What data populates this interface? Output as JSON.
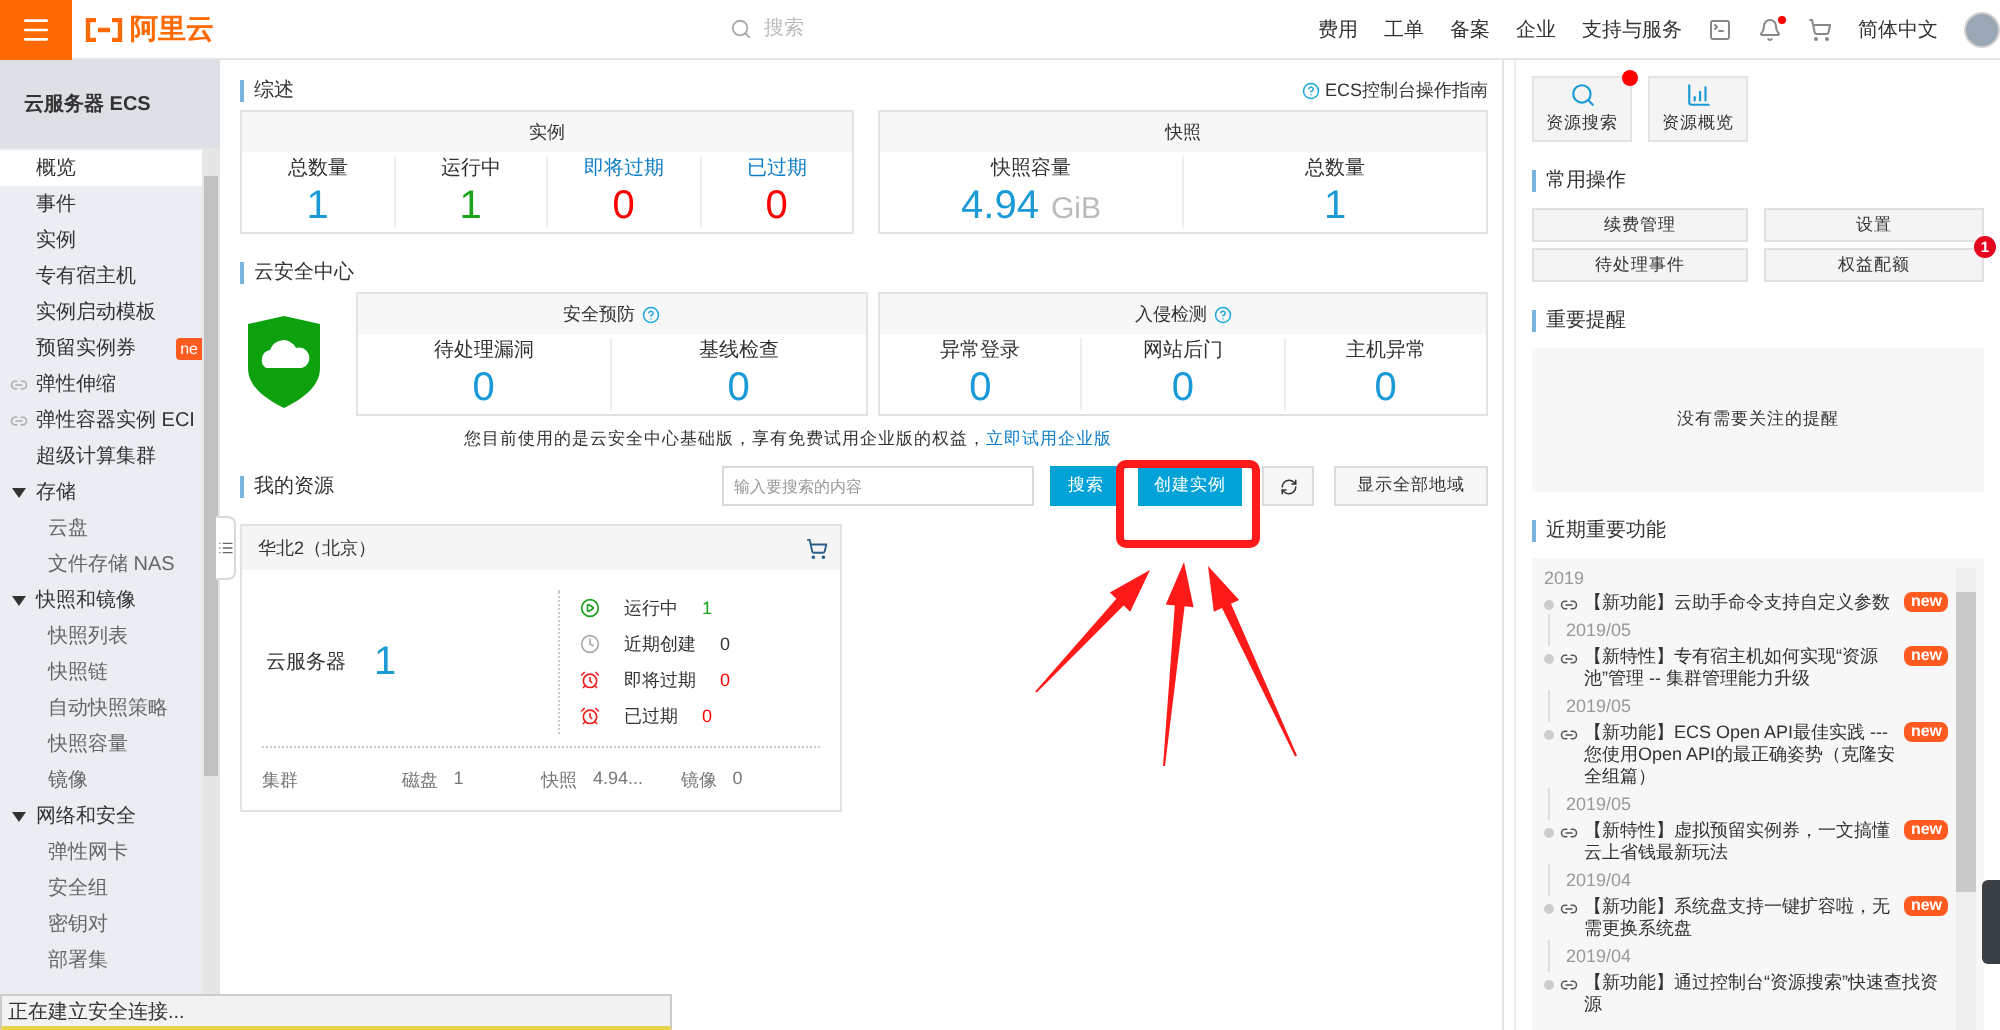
{
  "topbar": {
    "logo": "阿里云",
    "search_placeholder": "搜索",
    "nav": [
      "费用",
      "工单",
      "备案",
      "企业",
      "支持与服务"
    ],
    "notification_dot": true,
    "language": "简体中文"
  },
  "sidebar": {
    "title": "云服务器 ECS",
    "items": [
      {
        "kind": "item",
        "label": "概览",
        "selected": true
      },
      {
        "kind": "item",
        "label": "事件",
        "selected": false
      },
      {
        "kind": "item",
        "label": "实例",
        "selected": false
      },
      {
        "kind": "item",
        "label": "专有宿主机",
        "selected": false
      },
      {
        "kind": "item",
        "label": "实例启动模板",
        "selected": false
      },
      {
        "kind": "item",
        "label": "预留实例券",
        "selected": false,
        "badge": "ne"
      },
      {
        "kind": "link",
        "label": "弹性伸缩",
        "selected": false
      },
      {
        "kind": "link",
        "label": "弹性容器实例 ECI",
        "selected": false
      },
      {
        "kind": "item",
        "label": "超级计算集群",
        "selected": false
      },
      {
        "kind": "group",
        "label": "存储",
        "expanded": true,
        "children": [
          {
            "label": "云盘",
            "selected": false
          },
          {
            "label": "文件存储 NAS",
            "selected": false
          }
        ]
      },
      {
        "kind": "group",
        "label": "快照和镜像",
        "expanded": true,
        "children": [
          {
            "label": "快照列表",
            "selected": false
          },
          {
            "label": "快照链",
            "selected": false
          },
          {
            "label": "自动快照策略",
            "selected": false
          },
          {
            "label": "快照容量",
            "selected": false
          },
          {
            "label": "镜像",
            "selected": false
          }
        ]
      },
      {
        "kind": "group",
        "label": "网络和安全",
        "expanded": true,
        "children": [
          {
            "label": "弹性网卡",
            "selected": false
          },
          {
            "label": "安全组",
            "selected": false
          },
          {
            "label": "密钥对",
            "selected": false
          },
          {
            "label": "部署集",
            "selected": false
          }
        ]
      }
    ]
  },
  "overview": {
    "title": "综述",
    "help": "ECS控制台操作指南",
    "instances": {
      "title": "实例",
      "stats": [
        {
          "label": "总数量",
          "value": "1",
          "kind": "text",
          "color": "#1a9ad6"
        },
        {
          "label": "运行中",
          "value": "1",
          "kind": "text",
          "color": "#1ba21b"
        },
        {
          "label": "即将过期",
          "value": "0",
          "kind": "link",
          "color": "#ff0000"
        },
        {
          "label": "已过期",
          "value": "0",
          "kind": "link",
          "color": "#ff0000"
        }
      ]
    },
    "snapshots": {
      "title": "快照",
      "stats": [
        {
          "label": "快照容量",
          "value": "4.94",
          "unit": "GiB"
        },
        {
          "label": "总数量",
          "value": "1"
        }
      ]
    }
  },
  "security": {
    "title": "云安全中心",
    "cards": [
      {
        "title": "安全预防",
        "stats": [
          {
            "label": "待处理漏洞",
            "value": "0"
          },
          {
            "label": "基线检查",
            "value": "0"
          }
        ]
      },
      {
        "title": "入侵检测",
        "stats": [
          {
            "label": "异常登录",
            "value": "0"
          },
          {
            "label": "网站后门",
            "value": "0"
          },
          {
            "label": "主机异常",
            "value": "0"
          }
        ]
      }
    ],
    "note": "您目前使用的是云安全中心基础版，享有免费试用企业版的权益，",
    "note_link": "立即试用企业版"
  },
  "resources": {
    "title": "我的资源",
    "search_placeholder": "输入要搜索的内容",
    "search_button": "搜索",
    "create_button": "创建实例",
    "all_regions_button": "显示全部地域",
    "regions": [
      {
        "name": "华北2（北京）",
        "product": "云服务器",
        "count": "1",
        "statuses": [
          {
            "kind": "running",
            "label": "运行中",
            "value": "1"
          },
          {
            "kind": "recent",
            "label": "近期创建",
            "value": "0"
          },
          {
            "kind": "expiring",
            "label": "即将过期",
            "value": "0"
          },
          {
            "kind": "expired",
            "label": "已过期",
            "value": "0"
          }
        ],
        "footer": [
          {
            "label": "集群"
          },
          {
            "label": "磁盘",
            "value": "1"
          },
          {
            "label": "快照",
            "value": "4.94..."
          },
          {
            "label": "镜像",
            "value": "0"
          }
        ]
      }
    ]
  },
  "right_panel": {
    "quick": [
      {
        "label": "资源搜索",
        "alert": true
      },
      {
        "label": "资源概览",
        "alert": false
      }
    ],
    "common_title": "常用操作",
    "common": [
      {
        "label": "续费管理"
      },
      {
        "label": "设置"
      },
      {
        "label": "待处理事件"
      },
      {
        "label": "权益配额",
        "badge": "1"
      }
    ],
    "reminders_title": "重要提醒",
    "reminders_empty": "没有需要关注的提醒",
    "features_title": "近期重要功能",
    "features": {
      "year": "2019",
      "items": [
        {
          "text": "【新功能】云助手命令支持自定义参数",
          "badge": "new",
          "date": "2019/05"
        },
        {
          "text": "【新特性】专有宿主机如何实现“资源池”管理 -- 集群管理能力升级",
          "badge": "new",
          "date": "2019/05"
        },
        {
          "text": "【新功能】ECS Open API最佳实践 --- 您使用Open API的最正确姿势（克隆安全组篇）",
          "badge": "new",
          "date": "2019/05"
        },
        {
          "text": "【新特性】虚拟预留实例券，一文搞懂云上省钱最新玩法",
          "badge": "new",
          "date": "2019/04"
        },
        {
          "text": "【新功能】系统盘支持一键扩容啦，无需更换系统盘",
          "badge": "new",
          "date": "2019/04"
        },
        {
          "text": "【新功能】通过控制台“资源搜索”快速查找资源"
        }
      ]
    }
  },
  "status_bar": "正在建立安全连接..."
}
